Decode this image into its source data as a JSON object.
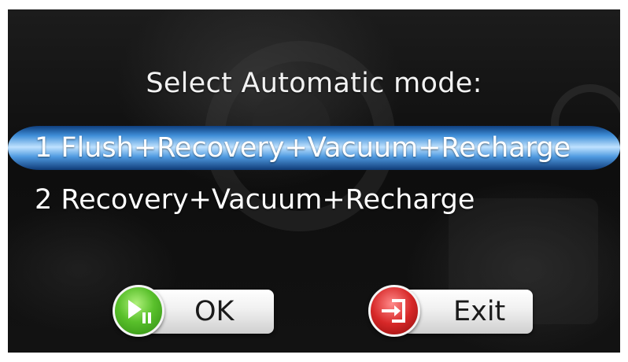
{
  "screen": {
    "title": "Select Automatic mode:",
    "options": [
      {
        "label": "1 Flush+Recovery+Vacuum+Recharge",
        "selected": true
      },
      {
        "label": "2 Recovery+Vacuum+Recharge",
        "selected": false
      }
    ]
  },
  "buttons": {
    "ok": {
      "label": "OK",
      "icon": "play-pause-icon",
      "color": "#59c02b"
    },
    "exit": {
      "label": "Exit",
      "icon": "exit-icon",
      "color": "#d72828"
    }
  },
  "colors": {
    "selection_highlight": "#3f8ed8",
    "background": "#121212",
    "text": "#ffffff"
  }
}
